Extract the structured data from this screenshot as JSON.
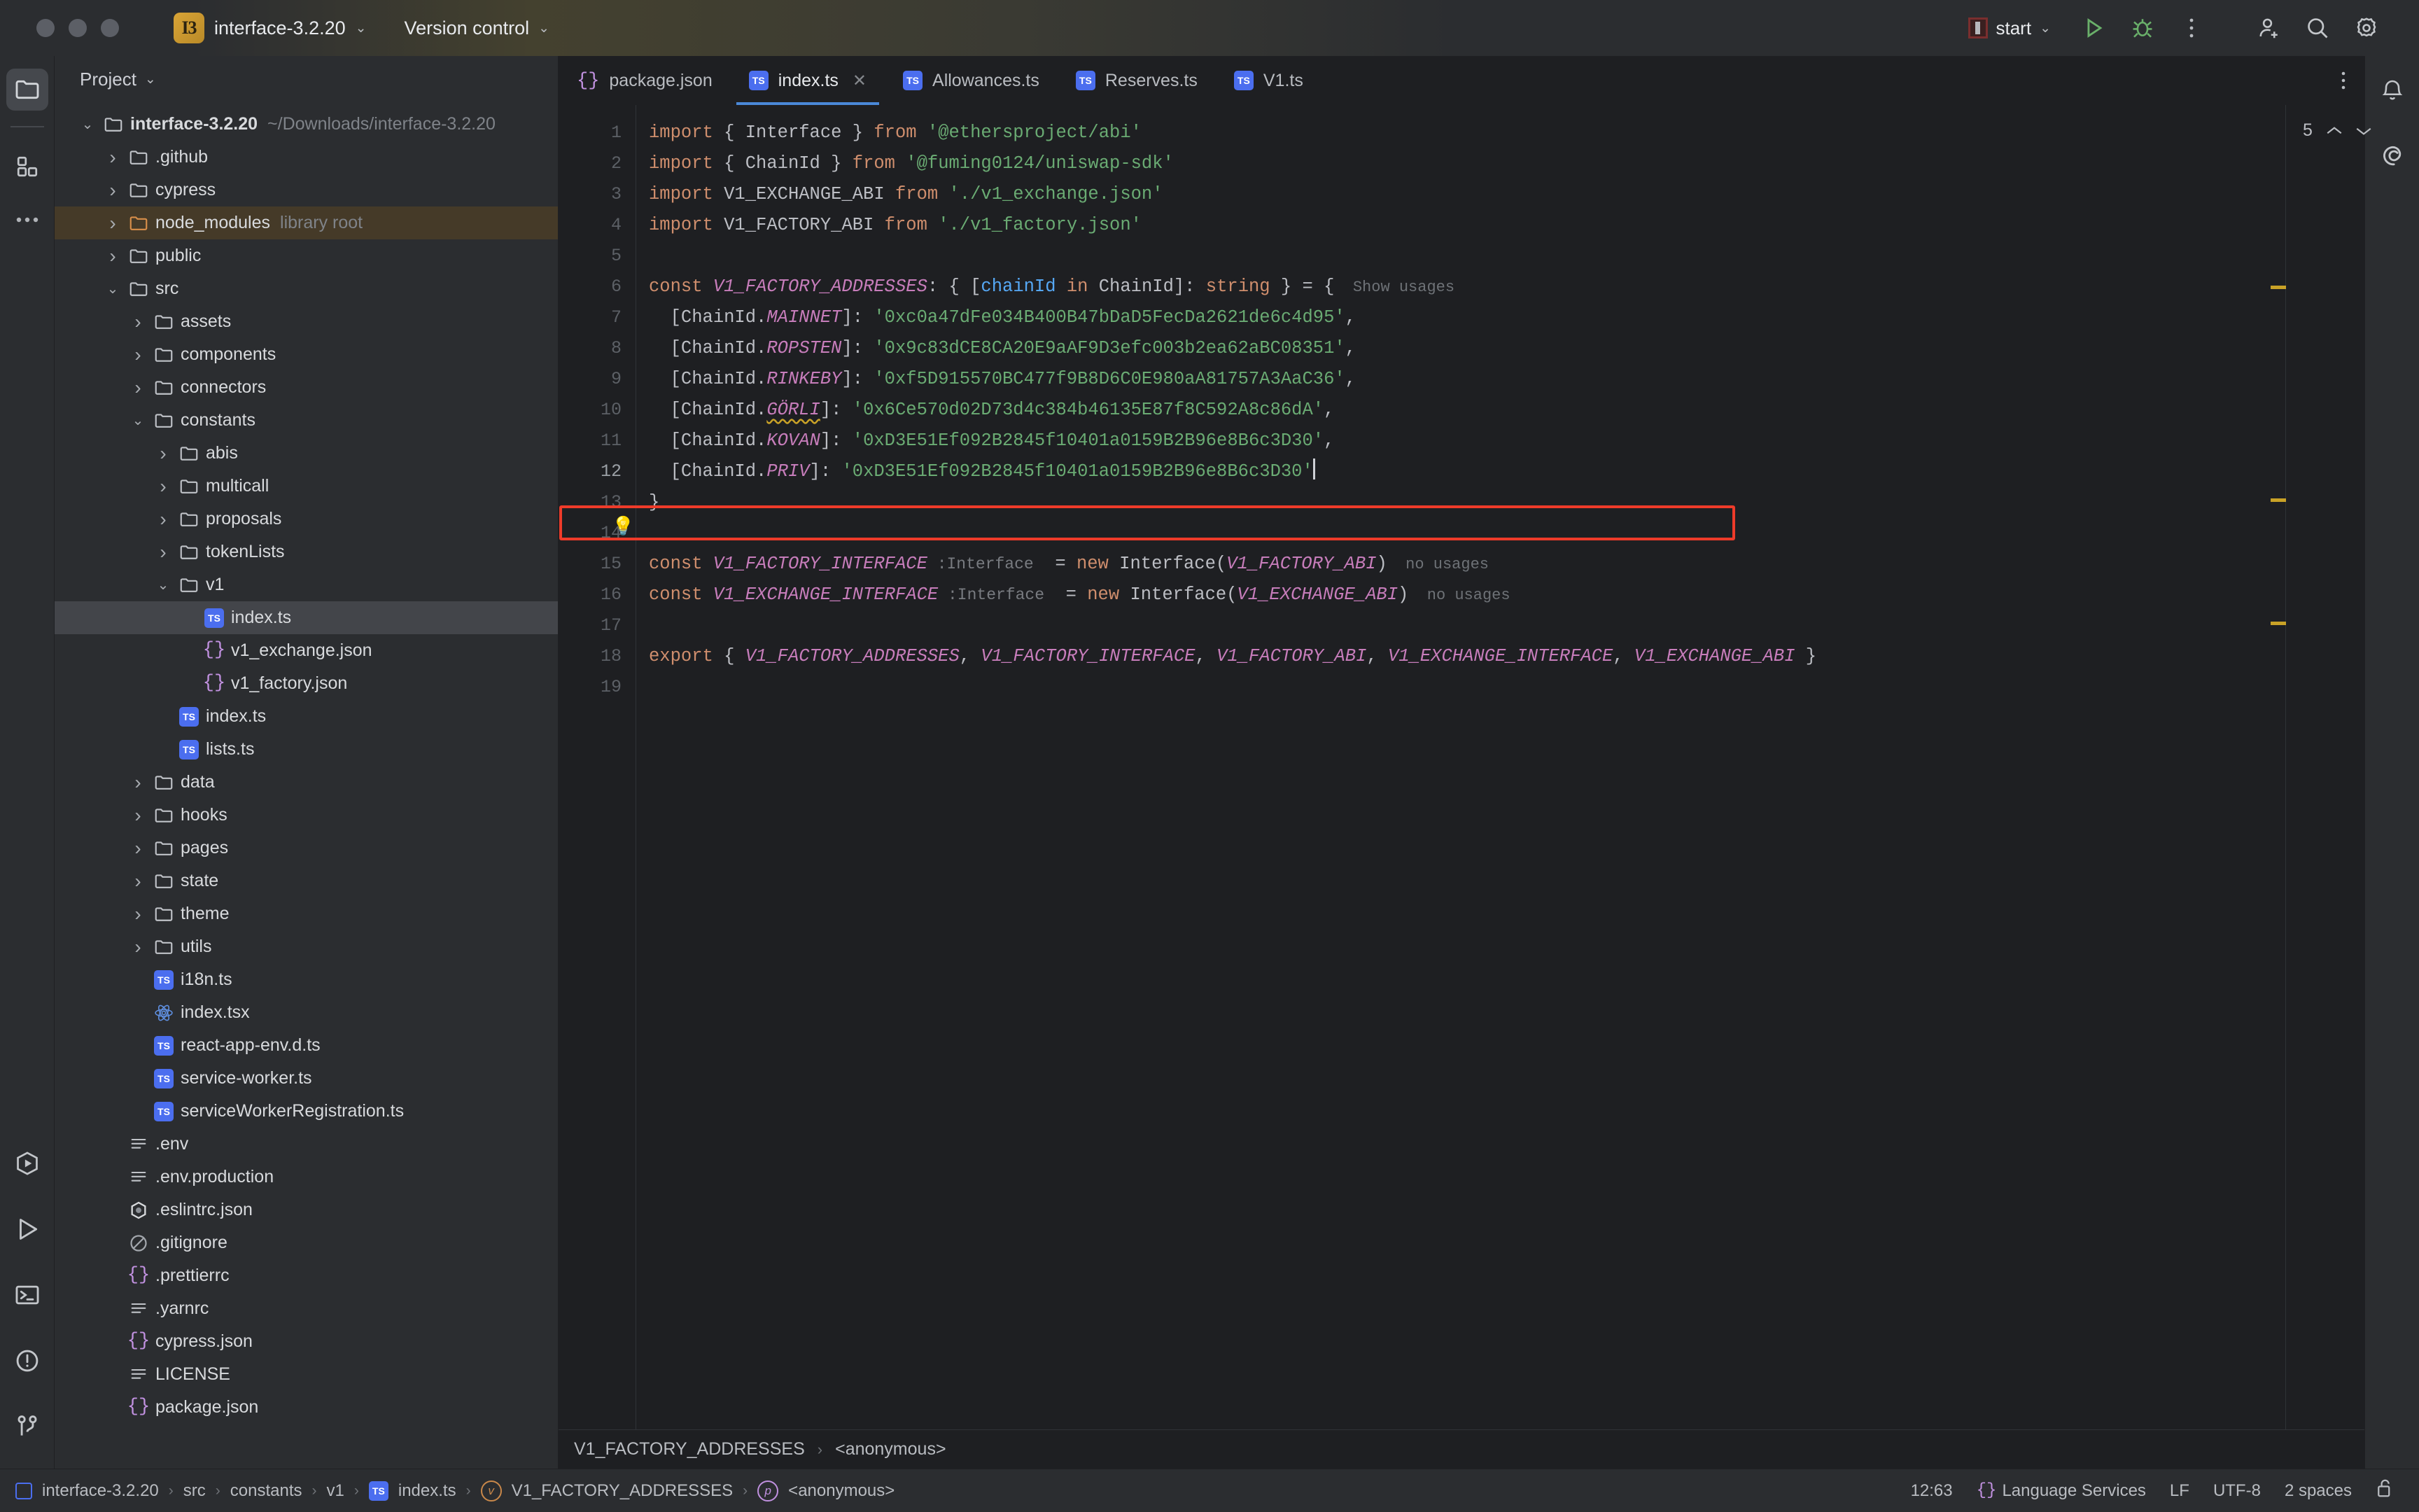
{
  "titlebar": {
    "ide_badge": "I3",
    "project_name": "interface-3.2.20",
    "vcs_label": "Version control",
    "run_config": "start",
    "icons": [
      "run-icon",
      "debug-icon",
      "more-options-icon",
      "add-collaborator-icon",
      "search-icon",
      "settings-icon"
    ]
  },
  "left_rail": {
    "items": [
      {
        "name": "project-tool-window",
        "icon": "folder-icon",
        "active": true
      },
      {
        "name": "structure-tool-window",
        "icon": "blocks-icon",
        "active": false
      },
      {
        "name": "more-tool-windows",
        "icon": "ellipsis-icon",
        "active": false
      }
    ],
    "bottom_items": [
      {
        "name": "run-anything",
        "icon": "hexagon-play-icon"
      },
      {
        "name": "run-tool-window",
        "icon": "play-icon"
      },
      {
        "name": "terminal-tool-window",
        "icon": "terminal-icon"
      },
      {
        "name": "problems-tool-window",
        "icon": "warning-circle-icon"
      },
      {
        "name": "version-control-tool-window",
        "icon": "branch-icon"
      }
    ]
  },
  "project": {
    "header": "Project",
    "tree": [
      {
        "indent": 0,
        "arrow": "down",
        "icon": "folder-icon",
        "label": "interface-3.2.20",
        "sub": "~/Downloads/interface-3.2.20",
        "bold": true
      },
      {
        "indent": 1,
        "arrow": "right",
        "icon": "folder-icon",
        "label": ".github"
      },
      {
        "indent": 1,
        "arrow": "right",
        "icon": "folder-icon",
        "label": "cypress"
      },
      {
        "indent": 1,
        "arrow": "right",
        "icon": "folder-orange-icon",
        "label": "node_modules",
        "sub": "library root",
        "state": "library"
      },
      {
        "indent": 1,
        "arrow": "right",
        "icon": "folder-icon",
        "label": "public"
      },
      {
        "indent": 1,
        "arrow": "down",
        "icon": "folder-icon",
        "label": "src"
      },
      {
        "indent": 2,
        "arrow": "right",
        "icon": "folder-icon",
        "label": "assets"
      },
      {
        "indent": 2,
        "arrow": "right",
        "icon": "folder-icon",
        "label": "components"
      },
      {
        "indent": 2,
        "arrow": "right",
        "icon": "folder-icon",
        "label": "connectors"
      },
      {
        "indent": 2,
        "arrow": "down",
        "icon": "folder-icon",
        "label": "constants"
      },
      {
        "indent": 3,
        "arrow": "right",
        "icon": "folder-icon",
        "label": "abis"
      },
      {
        "indent": 3,
        "arrow": "right",
        "icon": "folder-icon",
        "label": "multicall"
      },
      {
        "indent": 3,
        "arrow": "right",
        "icon": "folder-icon",
        "label": "proposals"
      },
      {
        "indent": 3,
        "arrow": "right",
        "icon": "folder-icon",
        "label": "tokenLists"
      },
      {
        "indent": 3,
        "arrow": "down",
        "icon": "folder-icon",
        "label": "v1"
      },
      {
        "indent": 4,
        "arrow": "none",
        "icon": "typescript-icon",
        "label": "index.ts",
        "state": "selected"
      },
      {
        "indent": 4,
        "arrow": "none",
        "icon": "json-icon",
        "label": "v1_exchange.json"
      },
      {
        "indent": 4,
        "arrow": "none",
        "icon": "json-icon",
        "label": "v1_factory.json"
      },
      {
        "indent": 3,
        "arrow": "none",
        "icon": "typescript-icon",
        "label": "index.ts"
      },
      {
        "indent": 3,
        "arrow": "none",
        "icon": "typescript-icon",
        "label": "lists.ts"
      },
      {
        "indent": 2,
        "arrow": "right",
        "icon": "folder-icon",
        "label": "data"
      },
      {
        "indent": 2,
        "arrow": "right",
        "icon": "folder-icon",
        "label": "hooks"
      },
      {
        "indent": 2,
        "arrow": "right",
        "icon": "folder-icon",
        "label": "pages"
      },
      {
        "indent": 2,
        "arrow": "right",
        "icon": "folder-icon",
        "label": "state"
      },
      {
        "indent": 2,
        "arrow": "right",
        "icon": "folder-icon",
        "label": "theme"
      },
      {
        "indent": 2,
        "arrow": "right",
        "icon": "folder-icon",
        "label": "utils"
      },
      {
        "indent": 2,
        "arrow": "none",
        "icon": "typescript-icon",
        "label": "i18n.ts"
      },
      {
        "indent": 2,
        "arrow": "none",
        "icon": "react-icon",
        "label": "index.tsx"
      },
      {
        "indent": 2,
        "arrow": "none",
        "icon": "typescript-icon",
        "label": "react-app-env.d.ts"
      },
      {
        "indent": 2,
        "arrow": "none",
        "icon": "typescript-icon",
        "label": "service-worker.ts"
      },
      {
        "indent": 2,
        "arrow": "none",
        "icon": "typescript-icon",
        "label": "serviceWorkerRegistration.ts"
      },
      {
        "indent": 1,
        "arrow": "none",
        "icon": "text-file-icon",
        "label": ".env"
      },
      {
        "indent": 1,
        "arrow": "none",
        "icon": "text-file-icon",
        "label": ".env.production"
      },
      {
        "indent": 1,
        "arrow": "none",
        "icon": "eslint-icon",
        "label": ".eslintrc.json"
      },
      {
        "indent": 1,
        "arrow": "none",
        "icon": "gitignore-icon",
        "label": ".gitignore"
      },
      {
        "indent": 1,
        "arrow": "none",
        "icon": "json-icon",
        "label": ".prettierrc"
      },
      {
        "indent": 1,
        "arrow": "none",
        "icon": "text-file-icon",
        "label": ".yarnrc"
      },
      {
        "indent": 1,
        "arrow": "none",
        "icon": "json-icon",
        "label": "cypress.json"
      },
      {
        "indent": 1,
        "arrow": "none",
        "icon": "text-file-icon",
        "label": "LICENSE"
      },
      {
        "indent": 1,
        "arrow": "none",
        "icon": "json-icon",
        "label": "package.json"
      }
    ]
  },
  "editor": {
    "tabs": [
      {
        "label": "package.json",
        "icon": "json-icon",
        "active": false,
        "closable": false
      },
      {
        "label": "index.ts",
        "icon": "typescript-icon",
        "active": true,
        "closable": true
      },
      {
        "label": "Allowances.ts",
        "icon": "typescript-icon",
        "active": false,
        "closable": false
      },
      {
        "label": "Reserves.ts",
        "icon": "typescript-icon",
        "active": false,
        "closable": false
      },
      {
        "label": "V1.ts",
        "icon": "typescript-icon",
        "active": false,
        "closable": false
      }
    ],
    "line_numbers": [
      "1",
      "2",
      "3",
      "4",
      "5",
      "6",
      "7",
      "8",
      "9",
      "10",
      "11",
      "12",
      "13",
      "14",
      "15",
      "16",
      "17",
      "18",
      "19"
    ],
    "current_line": 12,
    "inspections": {
      "warning_count": "5",
      "icon": "warning-triangle-icon"
    },
    "code_lines": [
      {
        "n": 1,
        "tokens": [
          {
            "t": "import ",
            "c": "kw"
          },
          {
            "t": "{ Interface } ",
            "c": "id"
          },
          {
            "t": "from ",
            "c": "kw"
          },
          {
            "t": "'@ethersproject/abi'",
            "c": "str"
          }
        ]
      },
      {
        "n": 2,
        "tokens": [
          {
            "t": "import ",
            "c": "kw"
          },
          {
            "t": "{ ChainId } ",
            "c": "id"
          },
          {
            "t": "from ",
            "c": "kw"
          },
          {
            "t": "'@fuming0124/uniswap-sdk'",
            "c": "str"
          }
        ]
      },
      {
        "n": 3,
        "tokens": [
          {
            "t": "import ",
            "c": "kw"
          },
          {
            "t": "V1_EXCHANGE_ABI ",
            "c": "id"
          },
          {
            "t": "from ",
            "c": "kw"
          },
          {
            "t": "'./v1_exchange.json'",
            "c": "str"
          }
        ]
      },
      {
        "n": 4,
        "tokens": [
          {
            "t": "import ",
            "c": "kw"
          },
          {
            "t": "V1_FACTORY_ABI ",
            "c": "id"
          },
          {
            "t": "from ",
            "c": "kw"
          },
          {
            "t": "'./v1_factory.json'",
            "c": "str"
          }
        ]
      },
      {
        "n": 5,
        "tokens": []
      },
      {
        "n": 6,
        "tokens": [
          {
            "t": "const ",
            "c": "kw"
          },
          {
            "t": "V1_FACTORY_ADDRESSES",
            "c": "field"
          },
          {
            "t": ": { [",
            "c": "id"
          },
          {
            "t": "chainId",
            "c": "param"
          },
          {
            "t": " in",
            "c": "kw"
          },
          {
            "t": " ChainId]: ",
            "c": "id"
          },
          {
            "t": "string",
            "c": "kw"
          },
          {
            "t": " } = {",
            "c": "id"
          },
          {
            "t": "  Show usages",
            "c": "usage"
          }
        ]
      },
      {
        "n": 7,
        "tokens": [
          {
            "t": "  [ChainId.",
            "c": "id"
          },
          {
            "t": "MAINNET",
            "c": "field"
          },
          {
            "t": "]: ",
            "c": "id"
          },
          {
            "t": "'0xc0a47dFe034B400B47bDaD5FecDa2621de6c4d95'",
            "c": "str"
          },
          {
            "t": ",",
            "c": "id"
          }
        ]
      },
      {
        "n": 8,
        "tokens": [
          {
            "t": "  [ChainId.",
            "c": "id"
          },
          {
            "t": "ROPSTEN",
            "c": "field"
          },
          {
            "t": "]: ",
            "c": "id"
          },
          {
            "t": "'0x9c83dCE8CA20E9aAF9D3efc003b2ea62aBC08351'",
            "c": "str"
          },
          {
            "t": ",",
            "c": "id"
          }
        ]
      },
      {
        "n": 9,
        "tokens": [
          {
            "t": "  [ChainId.",
            "c": "id"
          },
          {
            "t": "RINKEBY",
            "c": "field"
          },
          {
            "t": "]: ",
            "c": "id"
          },
          {
            "t": "'0xf5D915570BC477f9B8D6C0E980aA81757A3AaC36'",
            "c": "str"
          },
          {
            "t": ",",
            "c": "id"
          }
        ]
      },
      {
        "n": 10,
        "tokens": [
          {
            "t": "  [ChainId.",
            "c": "id"
          },
          {
            "t": "GÖRLI",
            "c": "field typo"
          },
          {
            "t": "]: ",
            "c": "id"
          },
          {
            "t": "'0x6Ce570d02D73d4c384b46135E87f8C592A8c86dA'",
            "c": "str"
          },
          {
            "t": ",",
            "c": "id"
          }
        ]
      },
      {
        "n": 11,
        "tokens": [
          {
            "t": "  [ChainId.",
            "c": "id"
          },
          {
            "t": "KOVAN",
            "c": "field"
          },
          {
            "t": "]: ",
            "c": "id"
          },
          {
            "t": "'0xD3E51Ef092B2845f10401a0159B2B96e8B6c3D30'",
            "c": "str"
          },
          {
            "t": ",",
            "c": "id"
          }
        ]
      },
      {
        "n": 12,
        "tokens": [
          {
            "t": "  [ChainId.",
            "c": "id"
          },
          {
            "t": "PRIV",
            "c": "field"
          },
          {
            "t": "]: ",
            "c": "id"
          },
          {
            "t": "'0xD3E51Ef092B2845f10401a0159B2B96e8B6c3D30'",
            "c": "str"
          }
        ],
        "caret": true
      },
      {
        "n": 13,
        "tokens": [
          {
            "t": "}",
            "c": "id"
          }
        ]
      },
      {
        "n": 14,
        "tokens": []
      },
      {
        "n": 15,
        "tokens": [
          {
            "t": "const ",
            "c": "kw"
          },
          {
            "t": "V1_FACTORY_INTERFACE",
            "c": "field"
          },
          {
            "t": " :Interface",
            "c": "hint"
          },
          {
            "t": "  = ",
            "c": "id"
          },
          {
            "t": "new ",
            "c": "kw"
          },
          {
            "t": "Interface(",
            "c": "id"
          },
          {
            "t": "V1_FACTORY_ABI",
            "c": "field"
          },
          {
            "t": ")",
            "c": "id"
          },
          {
            "t": "  no usages",
            "c": "usage"
          }
        ]
      },
      {
        "n": 16,
        "tokens": [
          {
            "t": "const ",
            "c": "kw"
          },
          {
            "t": "V1_EXCHANGE_INTERFACE",
            "c": "field"
          },
          {
            "t": " :Interface",
            "c": "hint"
          },
          {
            "t": "  = ",
            "c": "id"
          },
          {
            "t": "new ",
            "c": "kw"
          },
          {
            "t": "Interface(",
            "c": "id"
          },
          {
            "t": "V1_EXCHANGE_ABI",
            "c": "field"
          },
          {
            "t": ")",
            "c": "id"
          },
          {
            "t": "  no usages",
            "c": "usage"
          }
        ]
      },
      {
        "n": 17,
        "tokens": []
      },
      {
        "n": 18,
        "tokens": [
          {
            "t": "export ",
            "c": "kw"
          },
          {
            "t": "{ ",
            "c": "id"
          },
          {
            "t": "V1_FACTORY_ADDRESSES",
            "c": "field"
          },
          {
            "t": ", ",
            "c": "id"
          },
          {
            "t": "V1_FACTORY_INTERFACE",
            "c": "field"
          },
          {
            "t": ", ",
            "c": "id"
          },
          {
            "t": "V1_FACTORY_ABI",
            "c": "field"
          },
          {
            "t": ", ",
            "c": "id"
          },
          {
            "t": "V1_EXCHANGE_INTERFACE",
            "c": "field"
          },
          {
            "t": ", ",
            "c": "id"
          },
          {
            "t": "V1_EXCHANGE_ABI",
            "c": "field"
          },
          {
            "t": " }",
            "c": "id"
          }
        ]
      },
      {
        "n": 19,
        "tokens": []
      }
    ],
    "breadcrumbs": [
      "V1_FACTORY_ADDRESSES",
      "<anonymous>"
    ]
  },
  "status_bar": {
    "path": [
      {
        "label": "interface-3.2.20",
        "icon": "module-icon"
      },
      {
        "label": "src",
        "icon": null
      },
      {
        "label": "constants",
        "icon": null
      },
      {
        "label": "v1",
        "icon": null
      },
      {
        "label": "index.ts",
        "icon": "typescript-icon"
      },
      {
        "label": "V1_FACTORY_ADDRESSES",
        "icon": "variable-icon"
      },
      {
        "label": "<anonymous>",
        "icon": "property-icon"
      }
    ],
    "caret_position": "12:63",
    "language_services": "Language Services",
    "line_separator": "LF",
    "encoding": "UTF-8",
    "indent": "2 spaces",
    "lock_icon": "unlocked-icon"
  },
  "right_rail": {
    "items": [
      {
        "name": "notifications",
        "icon": "bell-icon"
      },
      {
        "name": "ai-assistant",
        "icon": "spiral-icon"
      }
    ]
  },
  "colors": {
    "bg_editor": "#1e1f22",
    "bg_panel": "#2b2d30",
    "accent_blue": "#4a88d8",
    "string_green": "#6aab73",
    "keyword_orange": "#cf8e6d",
    "field_pink": "#c77dbb",
    "error_red": "#ee3b2a",
    "warning_yellow": "#c9a227",
    "ts_blue": "#4b6eef"
  }
}
